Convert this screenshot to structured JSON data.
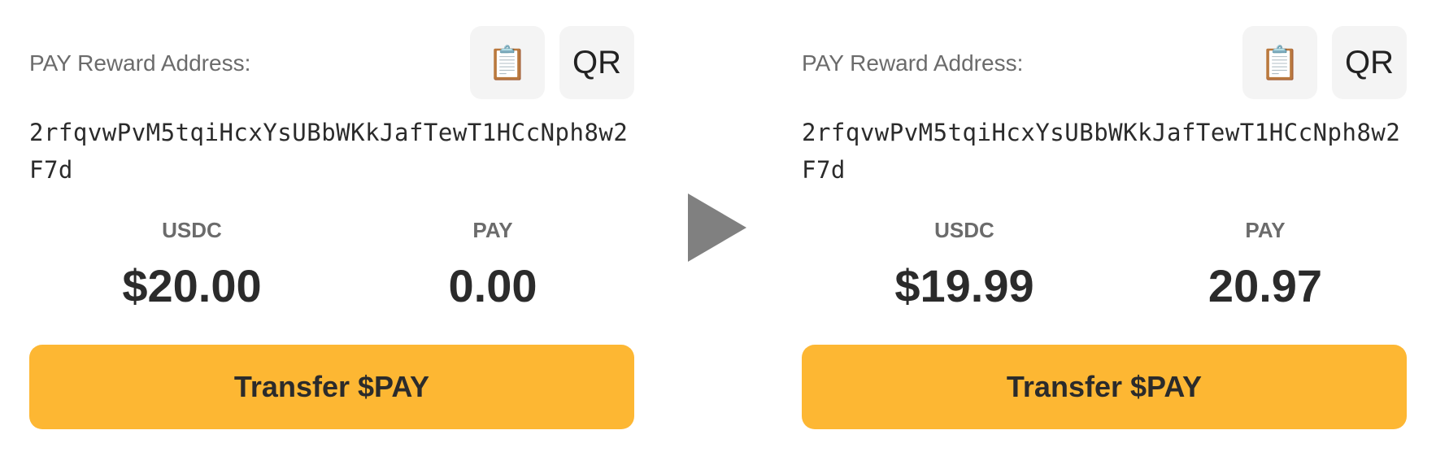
{
  "colors": {
    "accent": "#fdb733",
    "icon_button_bg": "#f4f4f4",
    "label_gray": "#6b6b6b",
    "text_dark": "#2b2b2b",
    "arrow_gray": "#808080"
  },
  "icons": {
    "copy": "clipboard-icon",
    "arrow": "play-arrow-icon"
  },
  "before": {
    "address_label": "PAY Reward Address:",
    "copy_icon_glyph": "📋",
    "qr_label": "QR",
    "address": "2rfqvwPvM5tqiHcxYsUBbWKkJafTewT1HCcNph8w2F7d",
    "usdc_label": "USDC",
    "usdc_value": "$20.00",
    "pay_label": "PAY",
    "pay_value": "0.00",
    "transfer_label": "Transfer $PAY"
  },
  "after": {
    "address_label": "PAY Reward Address:",
    "copy_icon_glyph": "📋",
    "qr_label": "QR",
    "address": "2rfqvwPvM5tqiHcxYsUBbWKkJafTewT1HCcNph8w2F7d",
    "usdc_label": "USDC",
    "usdc_value": "$19.99",
    "pay_label": "PAY",
    "pay_value": "20.97",
    "transfer_label": "Transfer $PAY"
  }
}
